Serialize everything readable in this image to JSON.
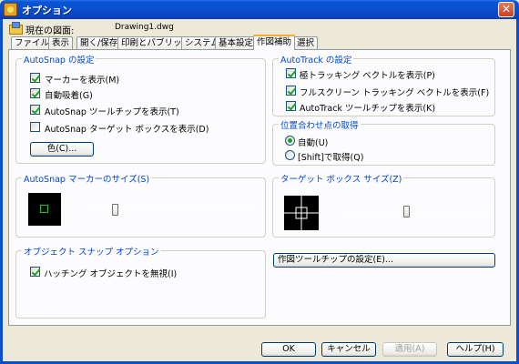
{
  "window": {
    "title": "オプション"
  },
  "current_drawing": {
    "label": "現在の図面:",
    "file": "Drawing1.dwg"
  },
  "tabs": [
    {
      "label": "ファイル"
    },
    {
      "label": "表示"
    },
    {
      "label": "開く/保存"
    },
    {
      "label": "印刷とパブリッシュ"
    },
    {
      "label": "システム"
    },
    {
      "label": "基本設定"
    },
    {
      "label": "作図補助"
    },
    {
      "label": "選択"
    }
  ],
  "active_tab": "作図補助",
  "autosnap": {
    "title": "AutoSnap の設定",
    "options": [
      {
        "label": "マーカーを表示(M)",
        "checked": true
      },
      {
        "label": "自動吸着(G)",
        "checked": true
      },
      {
        "label": "AutoSnap ツールチップを表示(T)",
        "checked": true
      },
      {
        "label": "AutoSnap ターゲット ボックスを表示(D)",
        "checked": false
      }
    ],
    "color_button": "色(C)..."
  },
  "autotrack": {
    "title": "AutoTrack の設定",
    "options": [
      {
        "label": "極トラッキング ベクトルを表示(P)",
        "checked": true
      },
      {
        "label": "フルスクリーン トラッキング ベクトルを表示(F)",
        "checked": true
      },
      {
        "label": "AutoTrack ツールチップを表示(K)",
        "checked": true
      }
    ]
  },
  "alignment": {
    "title": "位置合わせ点の取得",
    "options": [
      {
        "label": "自動(U)",
        "selected": true
      },
      {
        "label": "[Shift]で取得(Q)",
        "selected": false
      }
    ]
  },
  "marker_size": {
    "title": "AutoSnap マーカーのサイズ(S)",
    "slider_fraction": 0.45
  },
  "target_box_size": {
    "title": "ターゲット ボックス サイズ(Z)",
    "slider_fraction": 0.55
  },
  "osnap_options": {
    "title": "オブジェクト スナップ オプション",
    "options": [
      {
        "label": "ハッチング オブジェクトを無視(I)",
        "checked": true
      }
    ]
  },
  "tooltip_settings_button": "作図ツールチップの設定(E)...",
  "footer": {
    "ok": "OK",
    "cancel": "キャンセル",
    "apply": "適用(A)",
    "help": "ヘルプ(H)"
  },
  "colors": {
    "accent": "#0046d5",
    "titlebar": "#0a4fd0",
    "marker": "#21c021",
    "tab_highlight": "#f7a92c"
  }
}
